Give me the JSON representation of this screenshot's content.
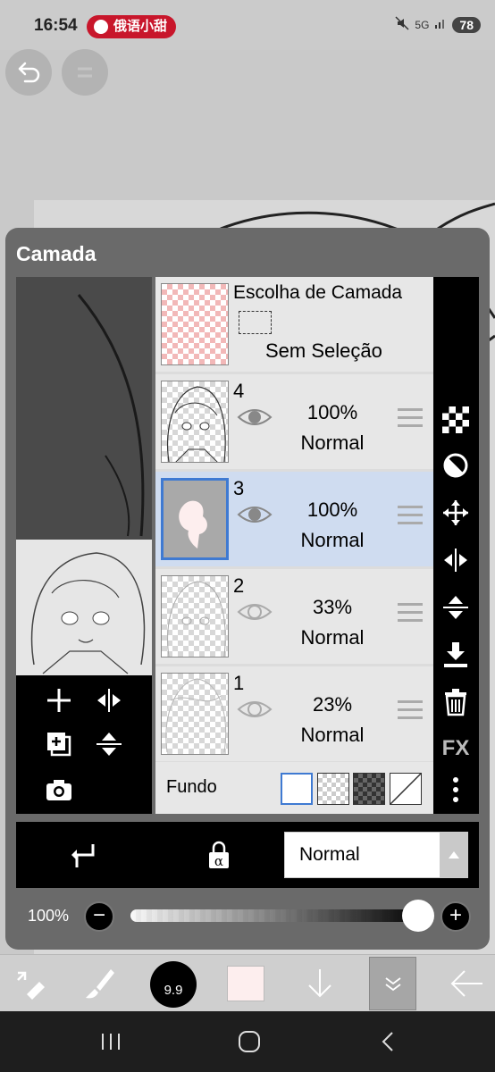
{
  "status_bar": {
    "time": "16:54",
    "notification_pill": "俄语小甜",
    "network": "5G",
    "battery": "78"
  },
  "panel": {
    "title": "Camada",
    "selection_layer": {
      "title": "Escolha de Camada",
      "status": "Sem Seleção"
    },
    "layers": [
      {
        "number": "4",
        "opacity": "100%",
        "blend": "Normal",
        "visible": true,
        "selected": false
      },
      {
        "number": "3",
        "opacity": "100%",
        "blend": "Normal",
        "visible": true,
        "selected": true
      },
      {
        "number": "2",
        "opacity": "33%",
        "blend": "Normal",
        "visible": true,
        "selected": false
      },
      {
        "number": "1",
        "opacity": "23%",
        "blend": "Normal",
        "visible": true,
        "selected": false
      }
    ],
    "background": {
      "label": "Fundo",
      "options": [
        "white",
        "transparent-light",
        "transparent-dark",
        "none"
      ],
      "selected": "white"
    },
    "right_tools": [
      "checker-icon",
      "circle-half-icon",
      "move-icon",
      "flip-horizontal-icon",
      "flip-vertical-icon",
      "merge-down-icon",
      "trash-icon",
      "fx-icon",
      "more-icon"
    ],
    "fx_label": "FX",
    "blend_mode": "Normal",
    "opacity_label": "100%",
    "opacity_value": 1.0,
    "minus_label": "−",
    "plus_label": "+"
  },
  "toolbar": {
    "brush_size": "9.9",
    "color": "#fdeeee"
  },
  "colors": {
    "selected_row": "#cfdcf0",
    "selection_border": "#3f7ad2",
    "panel_bg": "#6a6a6a"
  }
}
